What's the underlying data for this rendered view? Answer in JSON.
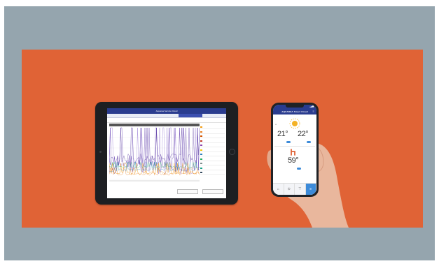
{
  "colors": {
    "slate": "#95a5ae",
    "orange": "#e06336",
    "navy": "#2a3c8f",
    "accent": "#3d8bd9",
    "sun": "#f4b223"
  },
  "tablet": {
    "title": "Aquarea Service Cloud",
    "tabs": [
      "",
      "",
      "",
      "",
      ""
    ],
    "active_tab": 3,
    "toolbar_left": "",
    "toolbar_right": "",
    "chart_header": "",
    "legend": [
      {
        "label": "",
        "color": "#f39c12"
      },
      {
        "label": "",
        "color": "#e67e22"
      },
      {
        "label": "",
        "color": "#d35400"
      },
      {
        "label": "",
        "color": "#c0392b"
      },
      {
        "label": "",
        "color": "#8e44ad"
      },
      {
        "label": "",
        "color": "#f1c40f"
      },
      {
        "label": "",
        "color": "#2980b9"
      },
      {
        "label": "",
        "color": "#27ae60"
      },
      {
        "label": "",
        "color": "#7f8c8d"
      },
      {
        "label": "",
        "color": "#16a085"
      },
      {
        "label": "",
        "color": "#34495e"
      }
    ],
    "buttons": [
      "",
      ""
    ]
  },
  "phone": {
    "status_time": "",
    "app_title": "AQUAREA Smart Cloud",
    "zone1_temp": "21°",
    "zone1_small": "",
    "zone2_temp": "22°",
    "zone2_small": "",
    "tank_temp": "59°",
    "tank_small": "",
    "nav_icons": [
      "home-icon",
      "thermometer-icon",
      "tap-icon",
      "settings-icon"
    ]
  }
}
